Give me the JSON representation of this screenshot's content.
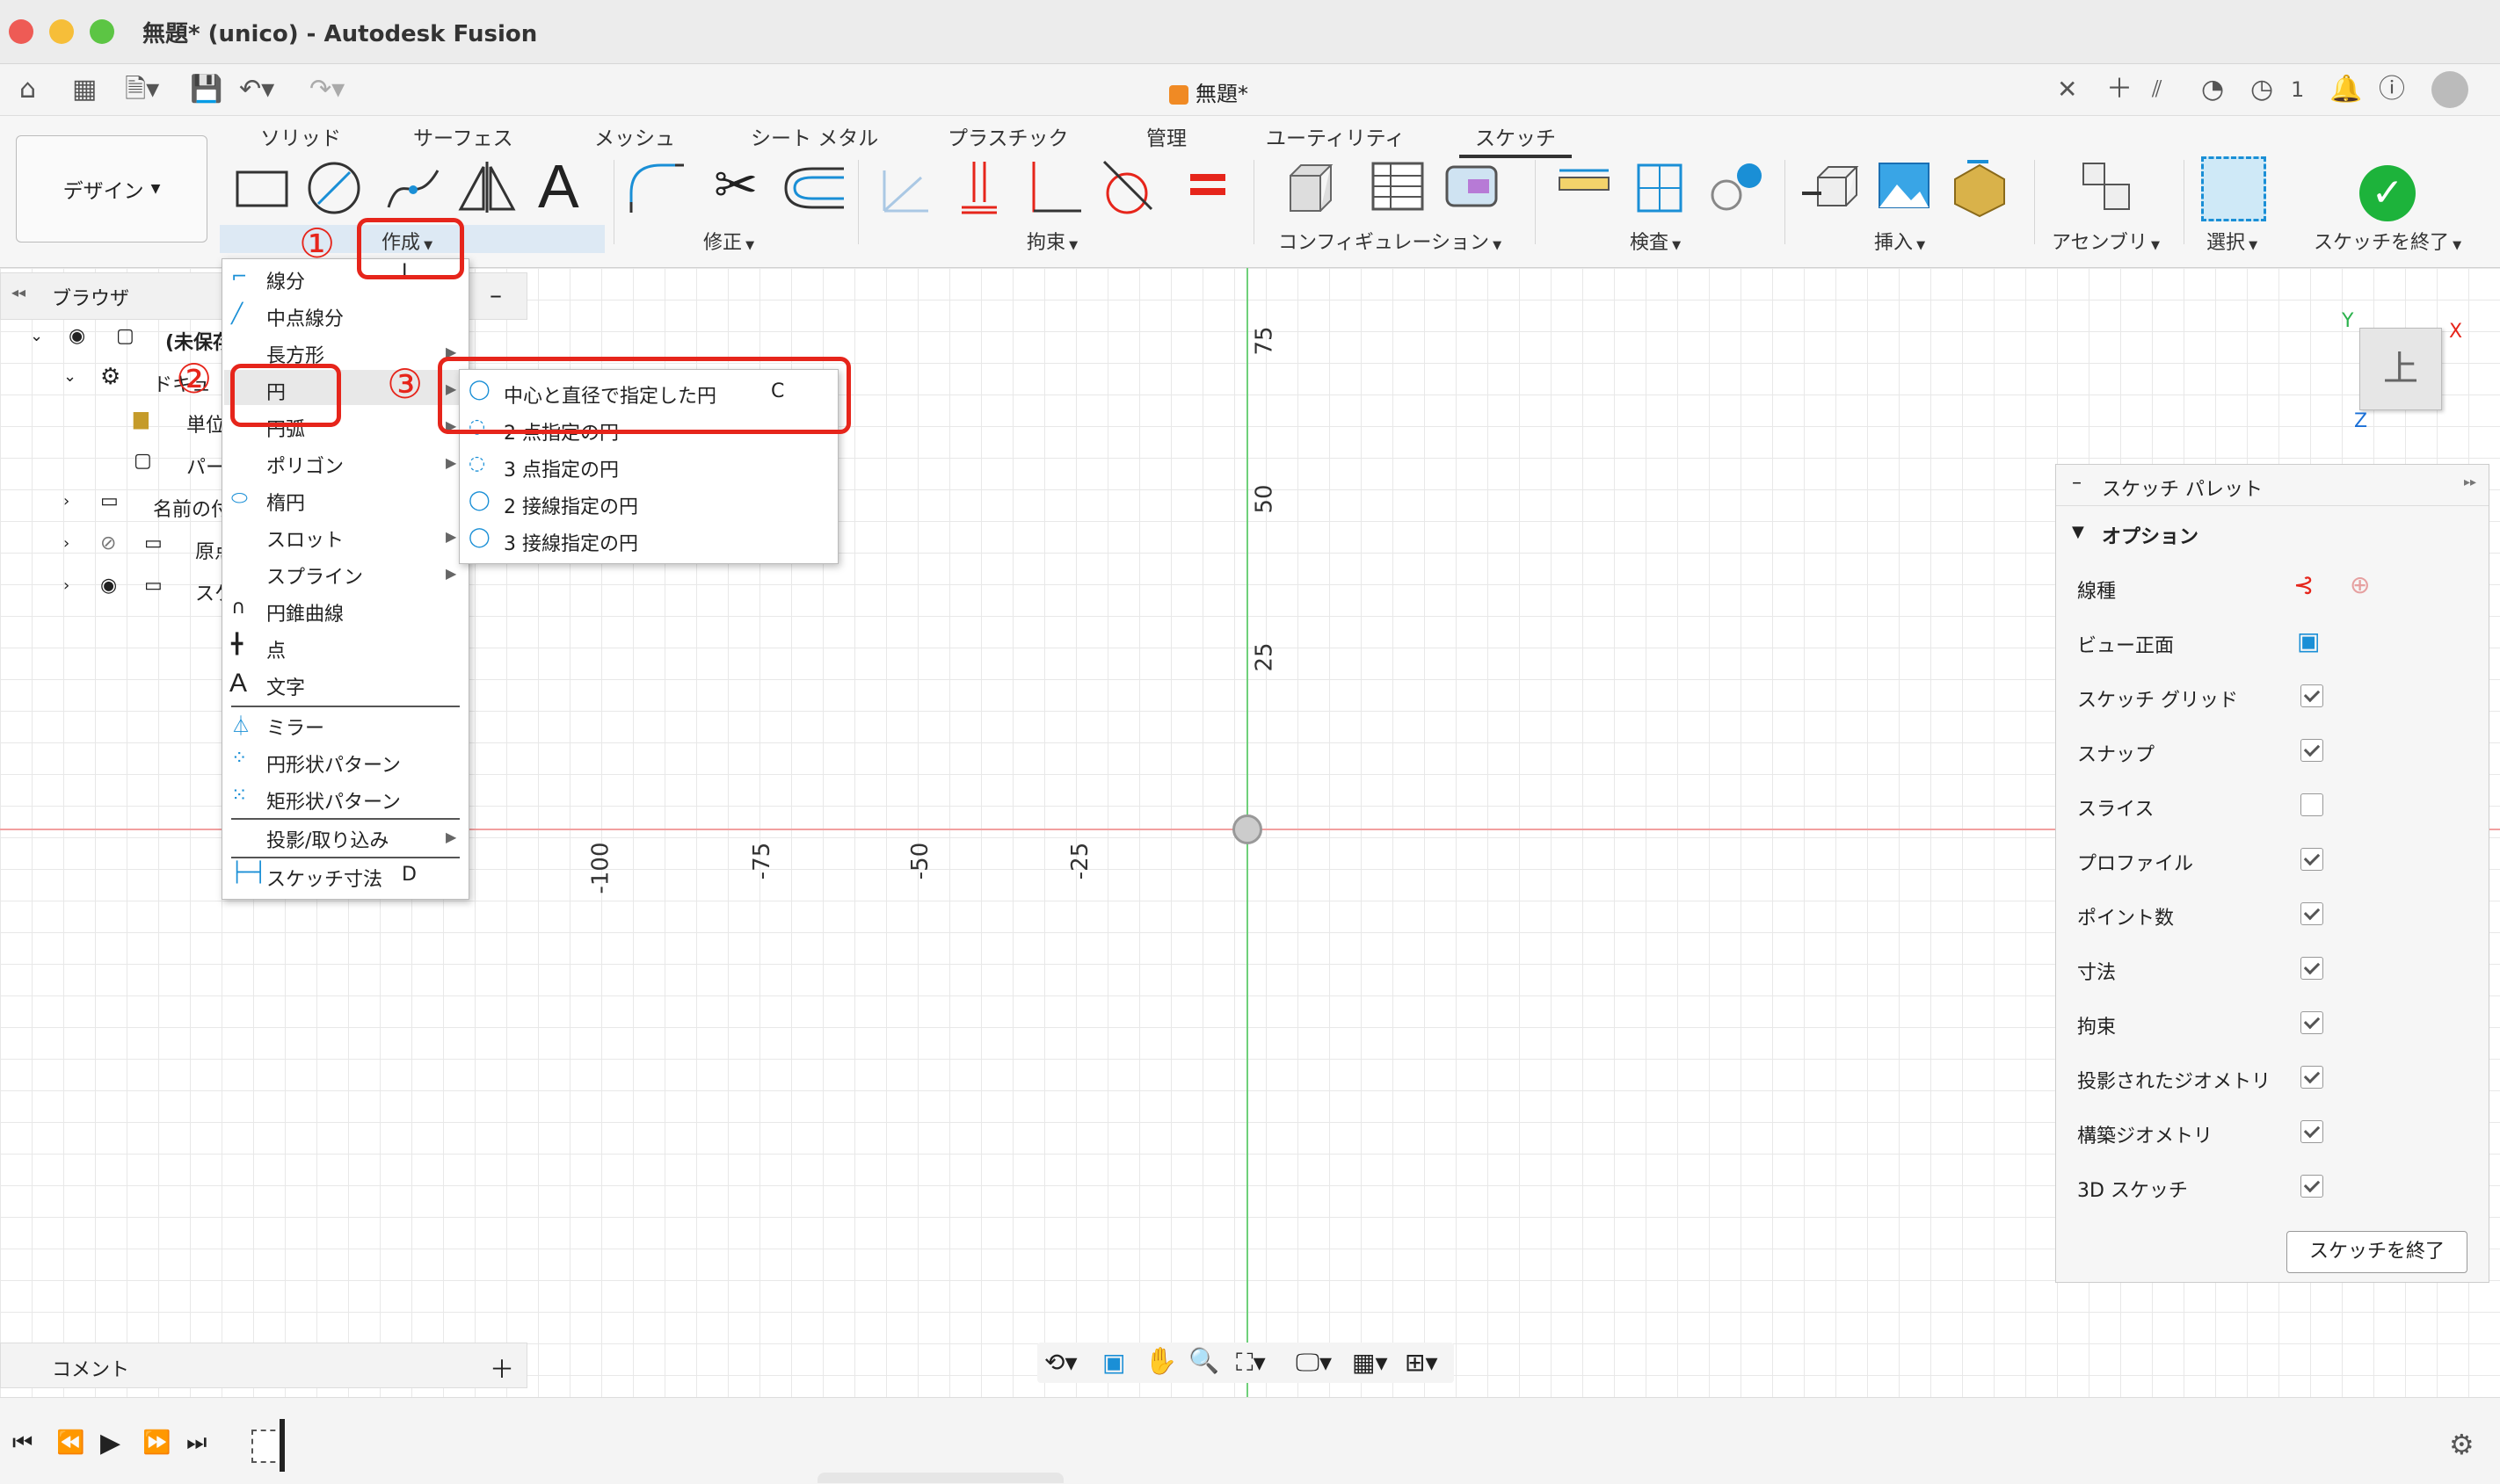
{
  "window": {
    "title": "無題* (unico) - Autodesk Fusion"
  },
  "tabstrip": {
    "doc_tab": "無題*",
    "job_count": "1"
  },
  "ribbon": {
    "tabs": [
      "ソリッド",
      "サーフェス",
      "メッシュ",
      "シート メタル",
      "プラスチック",
      "管理",
      "ユーティリティ",
      "スケッチ"
    ],
    "workspace": "デザイン",
    "groups": {
      "create": "作成",
      "modify": "修正",
      "constraints": "拘束",
      "configure": "コンフィギュレーション",
      "inspect": "検査",
      "insert": "挿入",
      "assemble": "アセンブリ",
      "select": "選択",
      "finish": "スケッチを終了"
    }
  },
  "browser": {
    "title": "ブラウザ",
    "rows": [
      "(未保存",
      "ドキュ",
      "単位",
      "パー",
      "名前の付",
      "原点",
      "スケ"
    ]
  },
  "create_menu": {
    "items": [
      {
        "label": "線分",
        "shortcut": "L"
      },
      {
        "label": "中点線分"
      },
      {
        "label": "長方形"
      },
      {
        "label": "円"
      },
      {
        "label": "円弧"
      },
      {
        "label": "ポリゴン"
      },
      {
        "label": "楕円"
      },
      {
        "label": "スロット"
      },
      {
        "label": "スプライン"
      },
      {
        "label": "円錐曲線"
      },
      {
        "label": "点"
      },
      {
        "label": "文字"
      },
      {
        "label": "ミラー"
      },
      {
        "label": "円形状パターン"
      },
      {
        "label": "矩形状パターン"
      },
      {
        "label": "投影/取り込み"
      },
      {
        "label": "スケッチ寸法",
        "shortcut": "D"
      }
    ]
  },
  "circle_submenu": {
    "items": [
      {
        "label": "中心と直径で指定した円",
        "shortcut": "C"
      },
      {
        "label": "2 点指定の円"
      },
      {
        "label": "3 点指定の円"
      },
      {
        "label": "2 接線指定の円"
      },
      {
        "label": "3 接線指定の円"
      }
    ]
  },
  "annotations": {
    "n1": "①",
    "n2": "②",
    "n3": "③"
  },
  "viewcube": {
    "face": "上",
    "x": "X",
    "y": "Y",
    "z": "Z"
  },
  "axis": {
    "y_ticks": [
      "75",
      "50",
      "25"
    ],
    "x_ticks": [
      "-100",
      "-75",
      "-50",
      "-25"
    ]
  },
  "palette": {
    "title": "スケッチ パレット",
    "section": "オプション",
    "linetype": "線種",
    "view_face": "ビュー正面",
    "options": [
      {
        "label": "スケッチ グリッド",
        "checked": true
      },
      {
        "label": "スナップ",
        "checked": true
      },
      {
        "label": "スライス",
        "checked": false
      },
      {
        "label": "プロファイル",
        "checked": true
      },
      {
        "label": "ポイント数",
        "checked": true
      },
      {
        "label": "寸法",
        "checked": true
      },
      {
        "label": "拘束",
        "checked": true
      },
      {
        "label": "投影されたジオメトリ",
        "checked": true
      },
      {
        "label": "構築ジオメトリ",
        "checked": true
      },
      {
        "label": "3D スケッチ",
        "checked": true
      }
    ],
    "finish_button": "スケッチを終了"
  },
  "comment": {
    "title": "コメント"
  },
  "colors": {
    "accent_red": "#e6251b",
    "finish_green": "#1db33b",
    "select_blue": "#1a8fd6"
  }
}
